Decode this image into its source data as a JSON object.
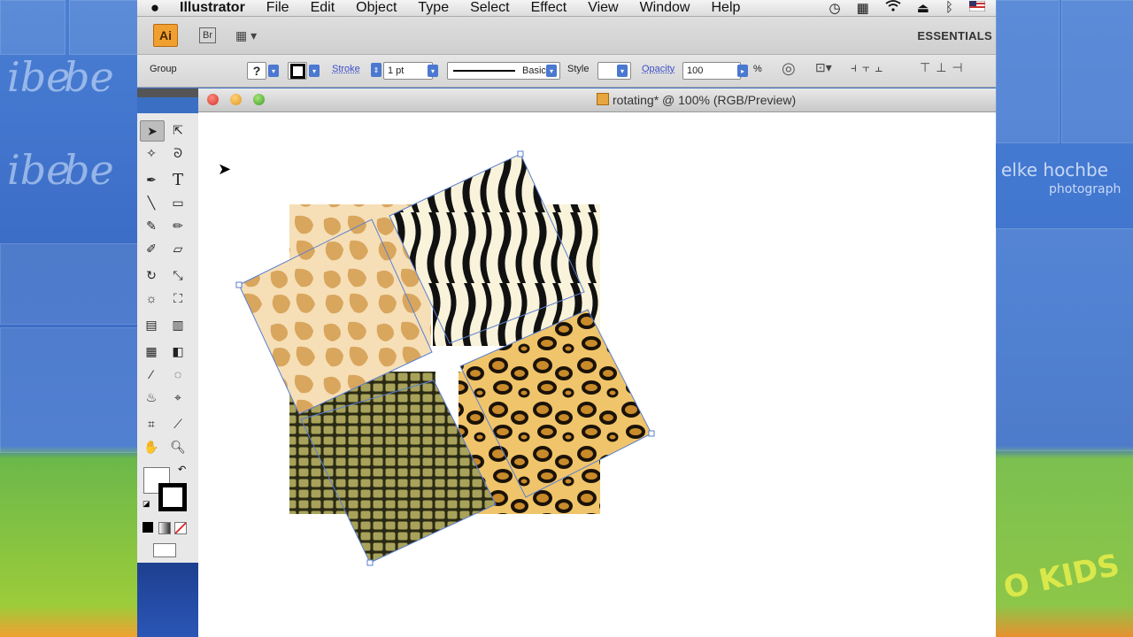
{
  "menubar": {
    "app_name": "Illustrator",
    "items": [
      "File",
      "Edit",
      "Object",
      "Type",
      "Select",
      "Effect",
      "View",
      "Window",
      "Help"
    ],
    "status_icons": [
      "time-machine-icon",
      "tiles-icon",
      "wifi-icon",
      "eject-icon",
      "bluetooth-icon",
      "flag-icon"
    ]
  },
  "appbar": {
    "logo": "Ai",
    "bridge": "Br",
    "workspace": "ESSENTIALS"
  },
  "controlbar": {
    "selection_type": "Group",
    "fill_value": "?",
    "stroke_label": "Stroke",
    "stroke_weight": "1 pt",
    "brush_label": "Basic",
    "style_label": "Style",
    "opacity_label": "Opacity",
    "opacity_value": "100",
    "percent": "%"
  },
  "document": {
    "title": "rotating* @ 100% (RGB/Preview)"
  },
  "background": {
    "brand_line1": "elke hochbe",
    "brand_line2": "photograph",
    "kids": "O KIDS"
  },
  "tools": [
    "selection-tool",
    "direct-selection-tool",
    "magic-wand-tool",
    "lasso-tool",
    "pen-tool",
    "type-tool",
    "line-tool",
    "rectangle-tool",
    "paintbrush-tool",
    "pencil-tool",
    "blob-brush-tool",
    "eraser-tool",
    "rotate-tool",
    "scale-tool",
    "warp-tool",
    "free-transform-tool",
    "symbol-sprayer-tool",
    "column-graph-tool",
    "mesh-tool",
    "gradient-tool",
    "eyedropper-tool",
    "blend-tool",
    "live-paint-bucket-tool",
    "live-paint-selection-tool",
    "artboard-tool",
    "slice-tool",
    "hand-tool",
    "zoom-tool"
  ],
  "colors": {
    "ai_orange": "#f0a030",
    "selection_blue": "#5a7fd0",
    "giraffe_base": "#f6dfb6",
    "giraffe_spot": "#d9a65e",
    "zebra_base": "#f8f3da",
    "leopard_base": "#f0c46a",
    "snake_base": "#a8a25a"
  }
}
